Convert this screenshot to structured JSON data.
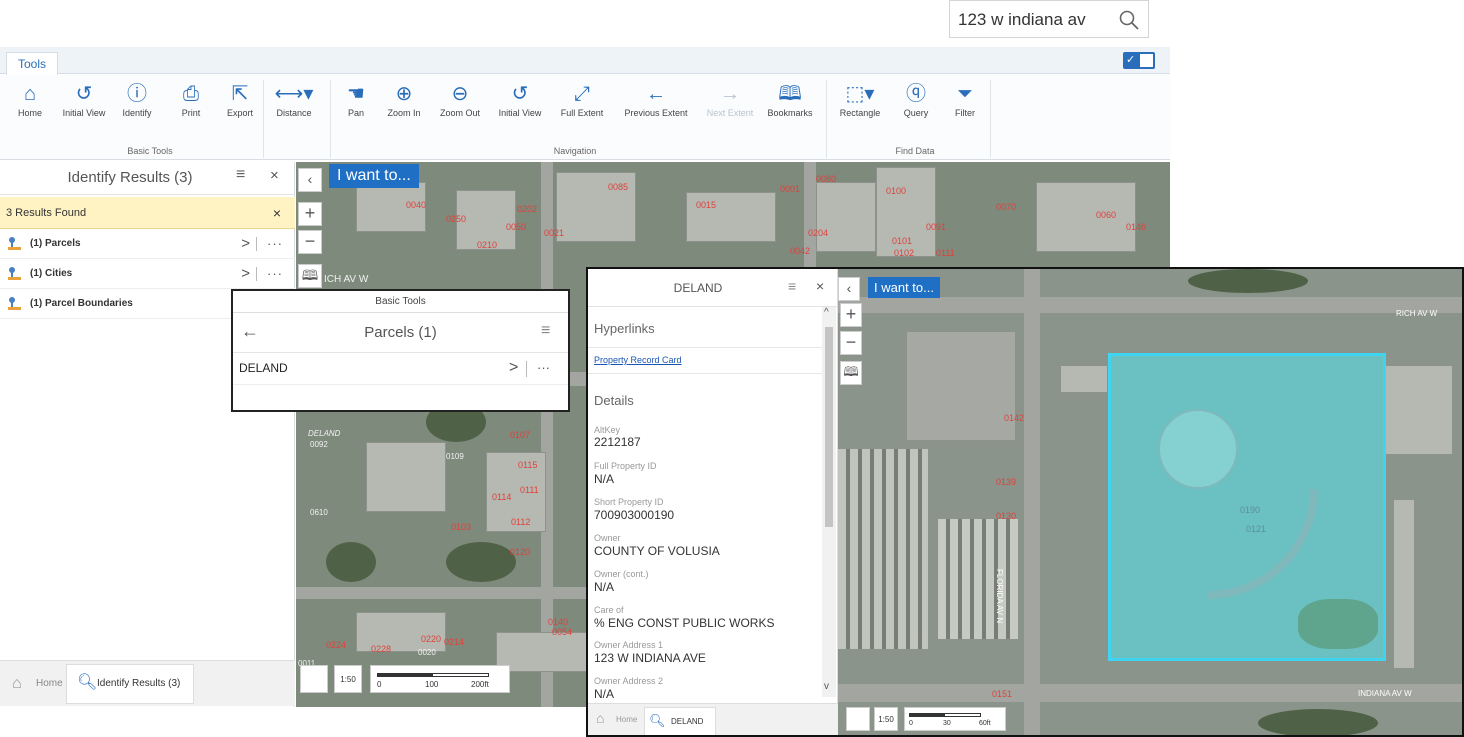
{
  "search": {
    "value": "123 w indiana av"
  },
  "tabs": {
    "tools": "Tools"
  },
  "ribbon": {
    "basic_tools": [
      {
        "label": "Home",
        "icon": "home-icon"
      },
      {
        "label": "Initial View",
        "icon": "refresh-icon"
      },
      {
        "label": "Identify",
        "icon": "identify-icon"
      },
      {
        "label": "Print",
        "icon": "print-icon"
      },
      {
        "label": "Export",
        "icon": "export-icon"
      }
    ],
    "distance": "Distance",
    "navigation": [
      {
        "label": "Pan"
      },
      {
        "label": "Zoom In"
      },
      {
        "label": "Zoom Out"
      },
      {
        "label": "Initial View"
      },
      {
        "label": "Full Extent"
      },
      {
        "label": "Previous Extent"
      },
      {
        "label": "Next Extent"
      },
      {
        "label": "Bookmarks"
      }
    ],
    "find_data": [
      {
        "label": "Rectangle"
      },
      {
        "label": "Query"
      },
      {
        "label": "Filter"
      }
    ],
    "group_basic": "Basic Tools",
    "group_nav": "Navigation",
    "group_find": "Find Data"
  },
  "left_panel": {
    "title": "Identify Results (3)",
    "results_found": "3 Results Found",
    "rows": [
      "(1) Parcels",
      "(1) Cities",
      "(1) Parcel Boundaries"
    ],
    "footer_home": "Home",
    "footer_identify": "Identify Results (3)"
  },
  "map": {
    "i_want_to": "I want to...",
    "scale_0": "0",
    "scale_100": "100",
    "scale_200": "200ft",
    "street_a": "ICH AV W",
    "parcel_labels": [
      "0040",
      "0202",
      "0050",
      "0250",
      "0210",
      "0021",
      "0085",
      "0015",
      "0001",
      "0080",
      "0100",
      "0091",
      "0070",
      "0060",
      "0146",
      "0204",
      "0042",
      "0101",
      "0102",
      "0111",
      "0107",
      "0115",
      "0111",
      "0114",
      "0112",
      "0120",
      "0103",
      "0140",
      "0054",
      "0224",
      "0228",
      "0220",
      "0214",
      "0020",
      "0011",
      "DELAND",
      "0109",
      "0092",
      "0610"
    ]
  },
  "parcels_popup": {
    "header": "Basic Tools",
    "title": "Parcels (1)",
    "row": "DELAND"
  },
  "detail_panel": {
    "title": "DELAND",
    "hyperlinks": "Hyperlinks",
    "link": "Property Record Card",
    "details": "Details",
    "fields": [
      {
        "label": "AltKey",
        "value": "2212187"
      },
      {
        "label": "Full Property ID",
        "value": "N/A"
      },
      {
        "label": "Short Property ID",
        "value": "700903000190"
      },
      {
        "label": "Owner",
        "value": "COUNTY OF VOLUSIA"
      },
      {
        "label": "Owner (cont.)",
        "value": "N/A"
      },
      {
        "label": "Care of",
        "value": "% ENG CONST PUBLIC WORKS"
      },
      {
        "label": "Owner Address 1",
        "value": "123 W INDIANA AVE"
      },
      {
        "label": "Owner Address 2",
        "value": "N/A"
      }
    ],
    "footer_home": "Home",
    "footer_tab": "DELAND"
  },
  "map2": {
    "i_want_to": "I want to...",
    "street_top": "RICH AV W",
    "street_bottom": "INDIANA AV W",
    "street_side": "FLORIDA AV N",
    "scale_0": "0",
    "scale_30": "30",
    "scale_60": "60ft",
    "parcel_labels": [
      "0142",
      "0190",
      "0121",
      "0130",
      "0139",
      "0151"
    ]
  },
  "colors": {
    "accent": "#2a6ebb",
    "highlight": "#3fd4f2",
    "results_bar": "#fff3c4"
  }
}
